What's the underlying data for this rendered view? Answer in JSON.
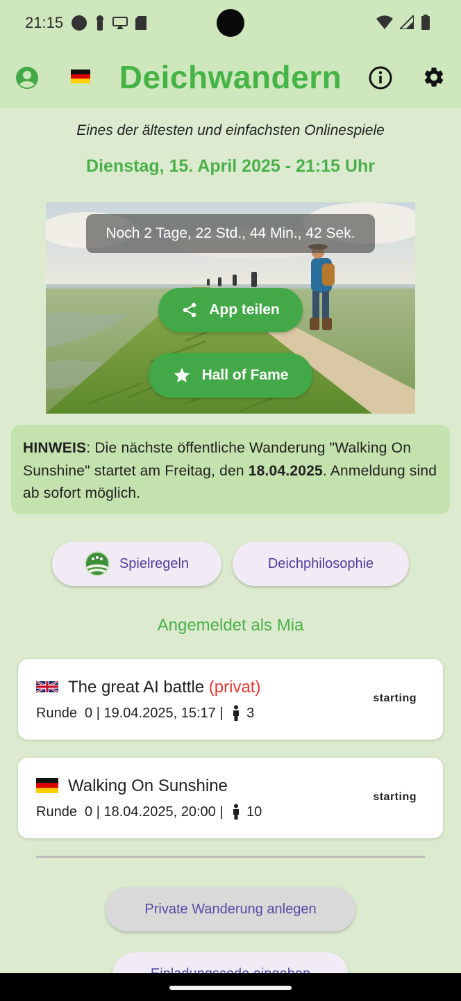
{
  "status_bar": {
    "time": "21:15",
    "left_icons": [
      "circle-notification-icon",
      "key-notification-icon",
      "cast-icon",
      "sd-card-icon"
    ],
    "right_icons": [
      "wifi-icon",
      "signal-icon",
      "battery-icon"
    ]
  },
  "app_bar": {
    "title": "Deichwandern",
    "language_flag": "german-flag-icon",
    "left_icon": "account-icon",
    "right_icons": [
      "info-icon",
      "gear-icon"
    ]
  },
  "subtitle": "Eines der ältesten und einfachsten Onlinespiele",
  "datetime": "Dienstag, 15. April 2025 - 21:15 Uhr",
  "hero": {
    "countdown": "Noch 2 Tage, 22 Std., 44 Min., 42 Sek.",
    "share_label": "App teilen",
    "hall_of_fame_label": "Hall of Fame"
  },
  "notice": {
    "label": "HINWEIS",
    "text_1": ": Die nächste öffentliche Wanderung \"Walking On Sunshine\" startet am Freitag, den ",
    "date": "18.04.2025",
    "text_2": ". Anmeldung sind ab sofort möglich."
  },
  "buttons": {
    "rules": "Spielregeln",
    "philosophy": "Deichphilosophie",
    "create_private": "Private Wanderung anlegen",
    "enter_invite": "Einladungscode eingeben"
  },
  "logged_in": "Angemeldet als Mia",
  "games": [
    {
      "flag": "uk-flag-icon",
      "name": "The great AI battle",
      "private_tag": "(privat)",
      "meta": "Runde  0 | 19.04.2025, 15:17 | ",
      "players": "3",
      "status": "starting"
    },
    {
      "flag": "german-flag-icon",
      "name": "Walking On Sunshine",
      "private_tag": "",
      "meta": "Runde  0 | 18.04.2025, 20:00 | ",
      "players": "10",
      "status": "starting"
    }
  ],
  "colors": {
    "brand_green": "#46b346",
    "button_green": "#43a847",
    "background": "#dcebcf",
    "appbar": "#cfe7bd",
    "notice_bg": "#c4e2ae",
    "purple_text": "#4d3e97",
    "private_red": "#e53935"
  }
}
